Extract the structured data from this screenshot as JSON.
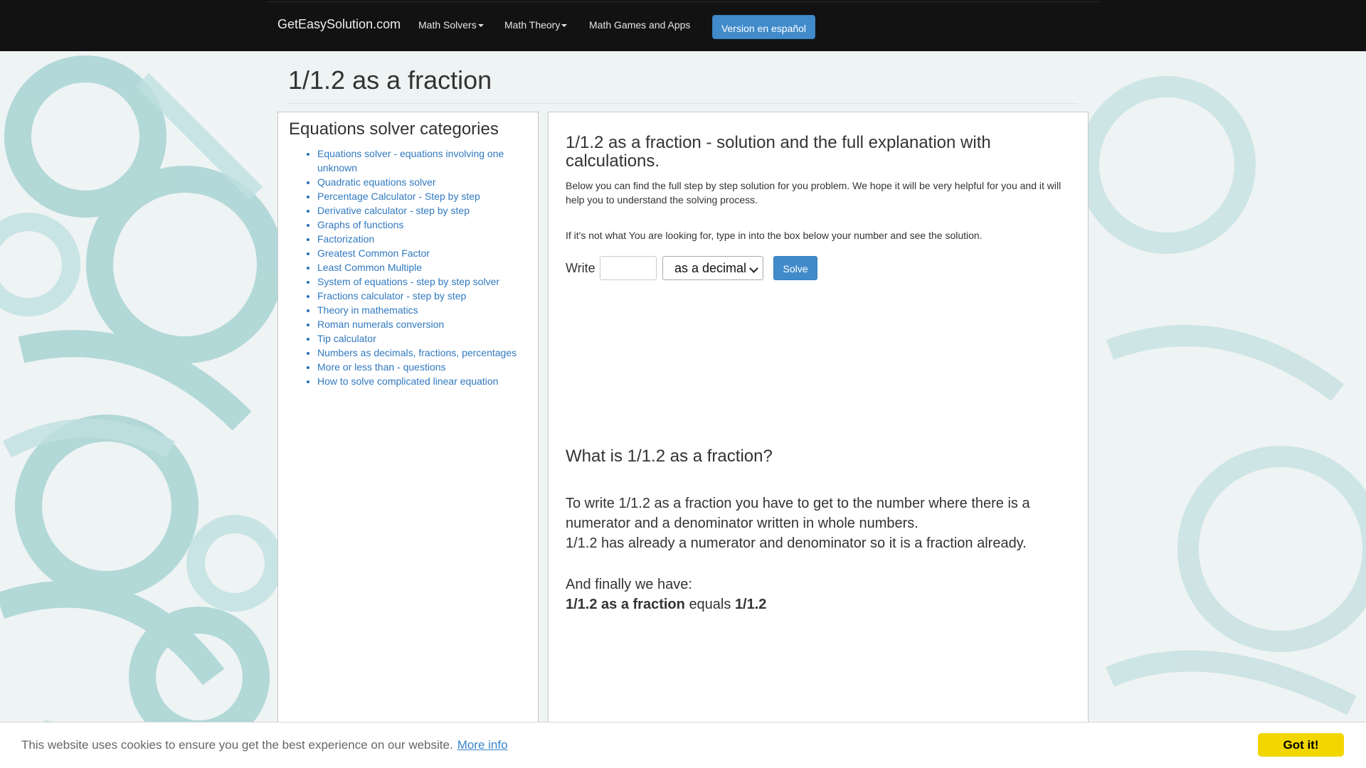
{
  "navbar": {
    "brand": "GetEasySolution.com",
    "items": [
      {
        "label": "Math Solvers",
        "dropdown": true
      },
      {
        "label": "Math Theory",
        "dropdown": true
      },
      {
        "label": "Math Games and Apps",
        "dropdown": false
      }
    ],
    "spanish_button": "Version en español"
  },
  "page": {
    "title": "1/1.2 as a fraction"
  },
  "sidebar": {
    "heading": "Equations solver categories",
    "items": [
      {
        "label": "Equations solver - equations involving one unknown"
      },
      {
        "label": "Quadratic equations solver"
      },
      {
        "label": "Percentage Calculator - Step by step"
      },
      {
        "label": "Derivative calculator - step by step"
      },
      {
        "label": "Graphs of functions"
      },
      {
        "label": "Factorization"
      },
      {
        "label": "Greatest Common Factor"
      },
      {
        "label": "Least Common Multiple"
      },
      {
        "label": "System of equations - step by step solver"
      },
      {
        "label": "Fractions calculator - step by step"
      },
      {
        "label": "Theory in mathematics"
      },
      {
        "label": "Roman numerals conversion"
      },
      {
        "label": "Tip calculator"
      },
      {
        "label": "Numbers as decimals, fractions, percentages"
      },
      {
        "label": "More or less than - questions"
      },
      {
        "label": "How to solve complicated linear equation"
      }
    ]
  },
  "main": {
    "heading": "1/1.2 as a fraction - solution and the full explanation with calculations.",
    "intro": "Below you can find the full step by step solution for you problem. We hope it will be very helpful for you and it will help you to understand the solving process.",
    "hint": "If it's not what You are looking for, type in into the box below your number and see the solution.",
    "form": {
      "write_label": "Write",
      "input_value": "",
      "select_value": "as a decimal",
      "solve_label": "Solve"
    },
    "question": "What is 1/1.2 as a fraction?",
    "explanation_line1": "To write 1/1.2 as a fraction you have to get to the number where there is a numerator and a denominator written in whole numbers.",
    "explanation_line2": "1/1.2 has already a numerator and denominator so it is a fraction already.",
    "final_intro": "And finally we have:",
    "final_bold": "1/1.2 as a fraction",
    "final_equals": "equals",
    "final_result": "1/1.2"
  },
  "cookie": {
    "text": "This website uses cookies to ensure you get the best experience on our website.",
    "link": "More info",
    "button": "Got it!"
  },
  "colors": {
    "navbar": "#121212",
    "accent": "#428bca",
    "link": "#3079c0",
    "cookie_button": "#f1d600"
  }
}
